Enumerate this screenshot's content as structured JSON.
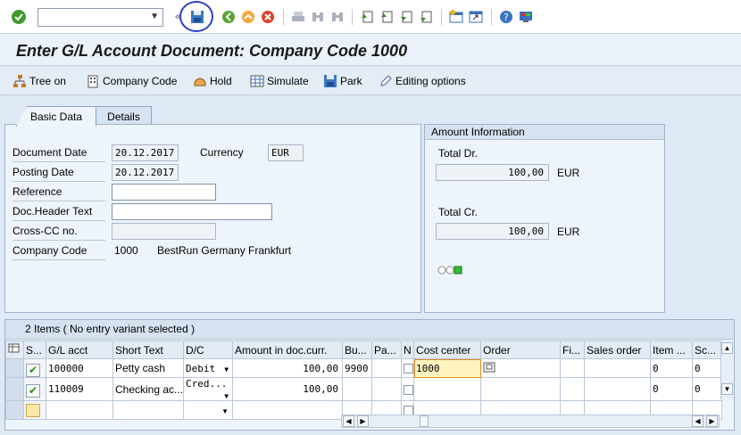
{
  "toolbar": {
    "command_field_value": "",
    "icons": [
      "check-icon",
      "command-dropdown",
      "back-arrows-icon",
      "save-icon",
      "back-icon",
      "exit-icon",
      "cancel-icon",
      "print-icon",
      "find-icon",
      "find-next-icon",
      "first-page-icon",
      "prev-page-icon",
      "next-page-icon",
      "last-page-icon",
      "new-session-icon",
      "shortcut-icon",
      "help-icon",
      "customize-layout-icon"
    ]
  },
  "title": "Enter G/L Account Document: Company Code 1000",
  "app_toolbar": {
    "tree_on": "Tree on",
    "company_code": "Company Code",
    "hold": "Hold",
    "simulate": "Simulate",
    "park": "Park",
    "editing_options": "Editing options"
  },
  "tabs": {
    "basic_data": "Basic Data",
    "details": "Details"
  },
  "basic": {
    "document_date_label": "Document Date",
    "document_date": "20.12.2017",
    "currency_label": "Currency",
    "currency": "EUR",
    "posting_date_label": "Posting Date",
    "posting_date": "20.12.2017",
    "reference_label": "Reference",
    "reference": "",
    "doc_header_label": "Doc.Header Text",
    "doc_header": "",
    "cross_cc_label": "Cross-CC no.",
    "cross_cc": "",
    "company_code_label": "Company Code",
    "company_code": "1000",
    "company_name": "BestRun Germany Frankfurt"
  },
  "amount_info": {
    "header": "Amount Information",
    "total_dr_label": "Total Dr.",
    "total_dr": "100,00",
    "total_dr_currency": "EUR",
    "total_cr_label": "Total Cr.",
    "total_cr": "100,00",
    "total_cr_currency": "EUR",
    "status_lights": "OOD"
  },
  "items": {
    "title": "2 Items ( No entry variant selected )",
    "columns": [
      "S...",
      "G/L acct",
      "Short Text",
      "D/C",
      "Amount in doc.curr.",
      "Bu...",
      "Pa...",
      "N",
      "Cost center",
      "Order",
      "Fi...",
      "Sales order",
      "Item ...",
      "Sc..."
    ],
    "rows": [
      {
        "gl": "100000",
        "text": "Petty cash",
        "dc": "Debit",
        "amount": "100,00",
        "bu": "9900",
        "cost_center": "1000",
        "item": "0",
        "sc": "0"
      },
      {
        "gl": "110009",
        "text": "Checking ac...",
        "dc": "Cred...",
        "amount": "100,00",
        "bu": "",
        "cost_center": "",
        "item": "0",
        "sc": "0"
      }
    ]
  },
  "colors": {
    "background": "#dfe9f5",
    "panel": "#eef4fb",
    "save_highlight_ring": "#2c3fc4",
    "status_green": "#2e8b1f"
  }
}
